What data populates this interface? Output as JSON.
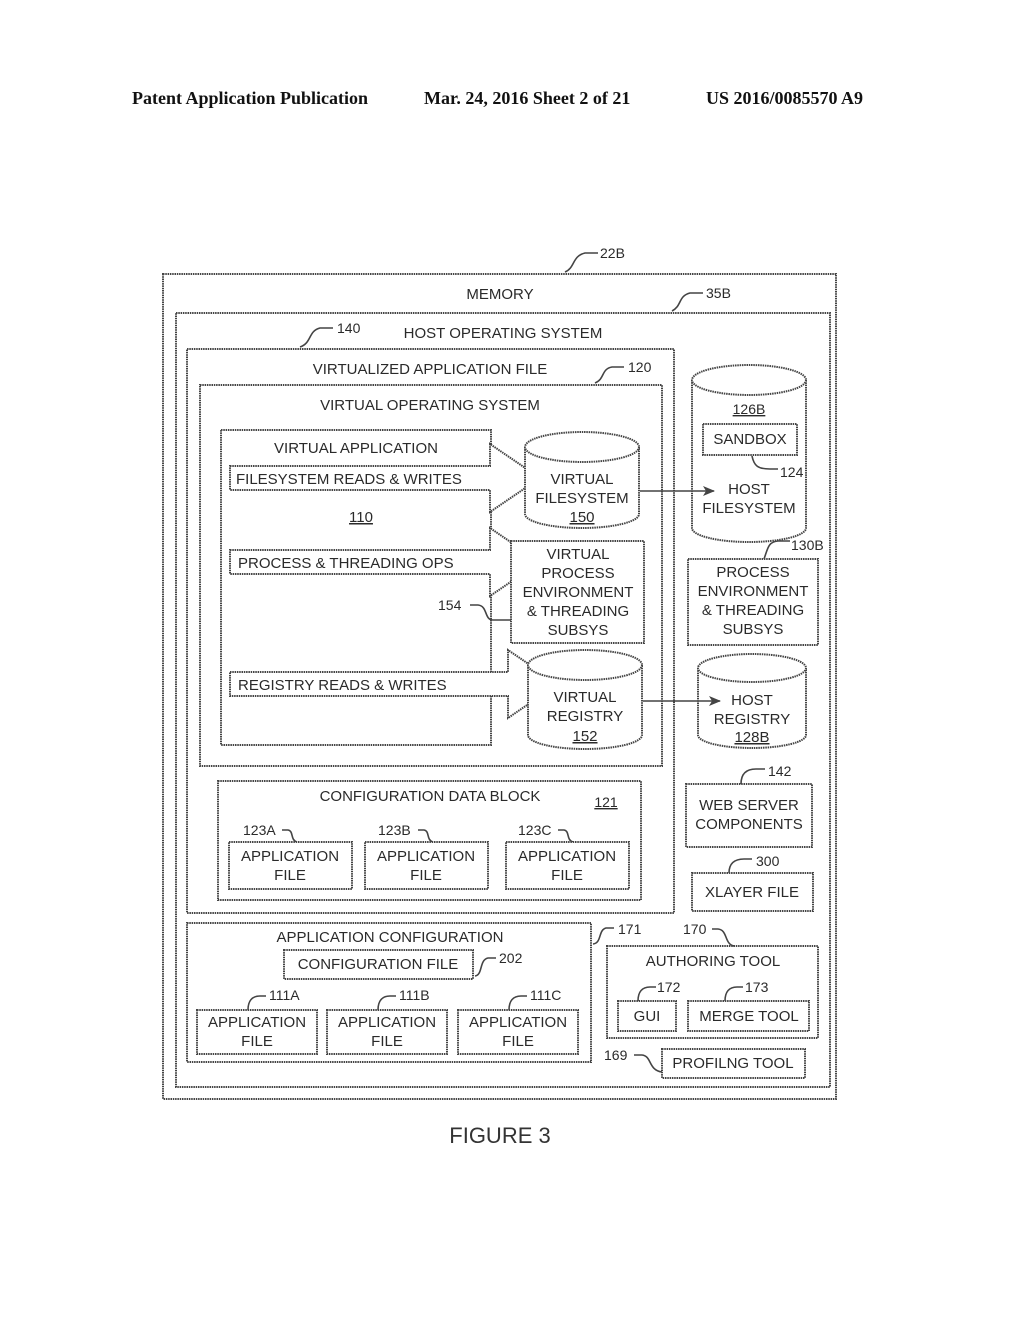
{
  "header": {
    "publication": "Patent Application Publication",
    "date_sheet": "Mar. 24, 2016  Sheet 2 of 21",
    "number": "US 2016/0085570 A9"
  },
  "figure": {
    "caption": "FIGURE 3",
    "memory": {
      "label": "MEMORY",
      "ref": "22B"
    },
    "host_os": {
      "label": "HOST OPERATING SYSTEM",
      "ref": "35B"
    },
    "virtualized_app_file": {
      "label": "VIRTUALIZED APPLICATION FILE",
      "ref": "140"
    },
    "virtual_os": {
      "label": "VIRTUAL OPERATING SYSTEM",
      "ref": "120"
    },
    "virtual_app": {
      "label": "VIRTUAL APPLICATION",
      "ref": "110"
    },
    "arrows": {
      "filesystem": "FILESYSTEM READS & WRITES",
      "process": "PROCESS & THREADING OPS",
      "registry": "REGISTRY READS & WRITES"
    },
    "virtual_filesystem": {
      "line1": "VIRTUAL",
      "line2": "FILESYSTEM",
      "ref": "150"
    },
    "virtual_process": {
      "lines": [
        "VIRTUAL",
        "PROCESS",
        "ENVIRONMENT",
        "& THREADING",
        "SUBSYS"
      ],
      "ref": "154"
    },
    "virtual_registry": {
      "line1": "VIRTUAL",
      "line2": "REGISTRY",
      "ref": "152"
    },
    "host_filesystem": {
      "line1": "HOST",
      "line2": "FILESYSTEM",
      "ref": "126B"
    },
    "sandbox": {
      "label": "SANDBOX",
      "ref": "124"
    },
    "host_process": {
      "lines": [
        "PROCESS",
        "ENVIRONMENT",
        "& THREADING",
        "SUBSYS"
      ],
      "ref": "130B"
    },
    "host_registry": {
      "line1": "HOST",
      "line2": "REGISTRY",
      "ref": "128B"
    },
    "web_server": {
      "line1": "WEB SERVER",
      "line2": "COMPONENTS",
      "ref": "142"
    },
    "xlayer": {
      "label": "XLAYER FILE",
      "ref": "300"
    },
    "config_data_block": {
      "label": "CONFIGURATION DATA BLOCK",
      "ref": "121",
      "files": [
        {
          "line1": "APPLICATION",
          "line2": "FILE",
          "ref": "123A"
        },
        {
          "line1": "APPLICATION",
          "line2": "FILE",
          "ref": "123B"
        },
        {
          "line1": "APPLICATION",
          "line2": "FILE",
          "ref": "123C"
        }
      ]
    },
    "app_config": {
      "label": "APPLICATION CONFIGURATION",
      "ref": "171",
      "config_file": {
        "label": "CONFIGURATION FILE",
        "ref": "202"
      },
      "files": [
        {
          "line1": "APPLICATION",
          "line2": "FILE",
          "ref": "111A"
        },
        {
          "line1": "APPLICATION",
          "line2": "FILE",
          "ref": "111B"
        },
        {
          "line1": "APPLICATION",
          "line2": "FILE",
          "ref": "111C"
        }
      ]
    },
    "authoring_tool": {
      "label": "AUTHORING TOOL",
      "ref": "170",
      "gui": {
        "label": "GUI",
        "ref": "172"
      },
      "merge": {
        "label": "MERGE TOOL",
        "ref": "173"
      }
    },
    "profiling_tool": {
      "label": "PROFILNG TOOL",
      "ref": "169"
    }
  }
}
